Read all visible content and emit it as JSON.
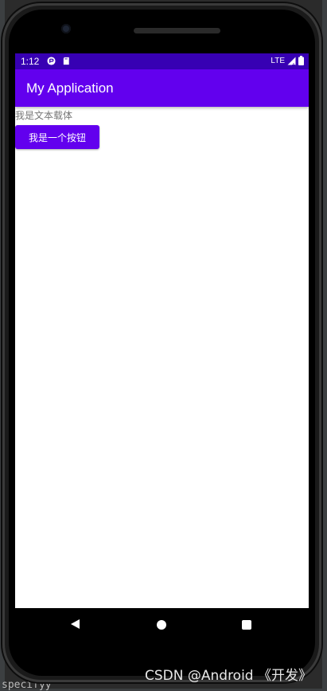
{
  "status_bar": {
    "time": "1:12",
    "network": "LTE",
    "icons": [
      "gmail-status-icon",
      "sd-card-icon",
      "signal-icon",
      "battery-icon"
    ]
  },
  "app_bar": {
    "title": "My Application"
  },
  "content": {
    "text_label": "我是文本载体",
    "button_label": "我是一个按钮"
  },
  "navigation": {
    "icons": [
      "back-icon",
      "home-icon",
      "recent-apps-icon"
    ]
  },
  "background_ide": {
    "bottom_text": "specifyy"
  },
  "watermark": {
    "text": "CSDN @Android 《开发》"
  },
  "colors": {
    "status_bar": "#3700b3",
    "primary": "#6200ee",
    "screen_bg": "#ffffff",
    "text_secondary": "#757575"
  }
}
